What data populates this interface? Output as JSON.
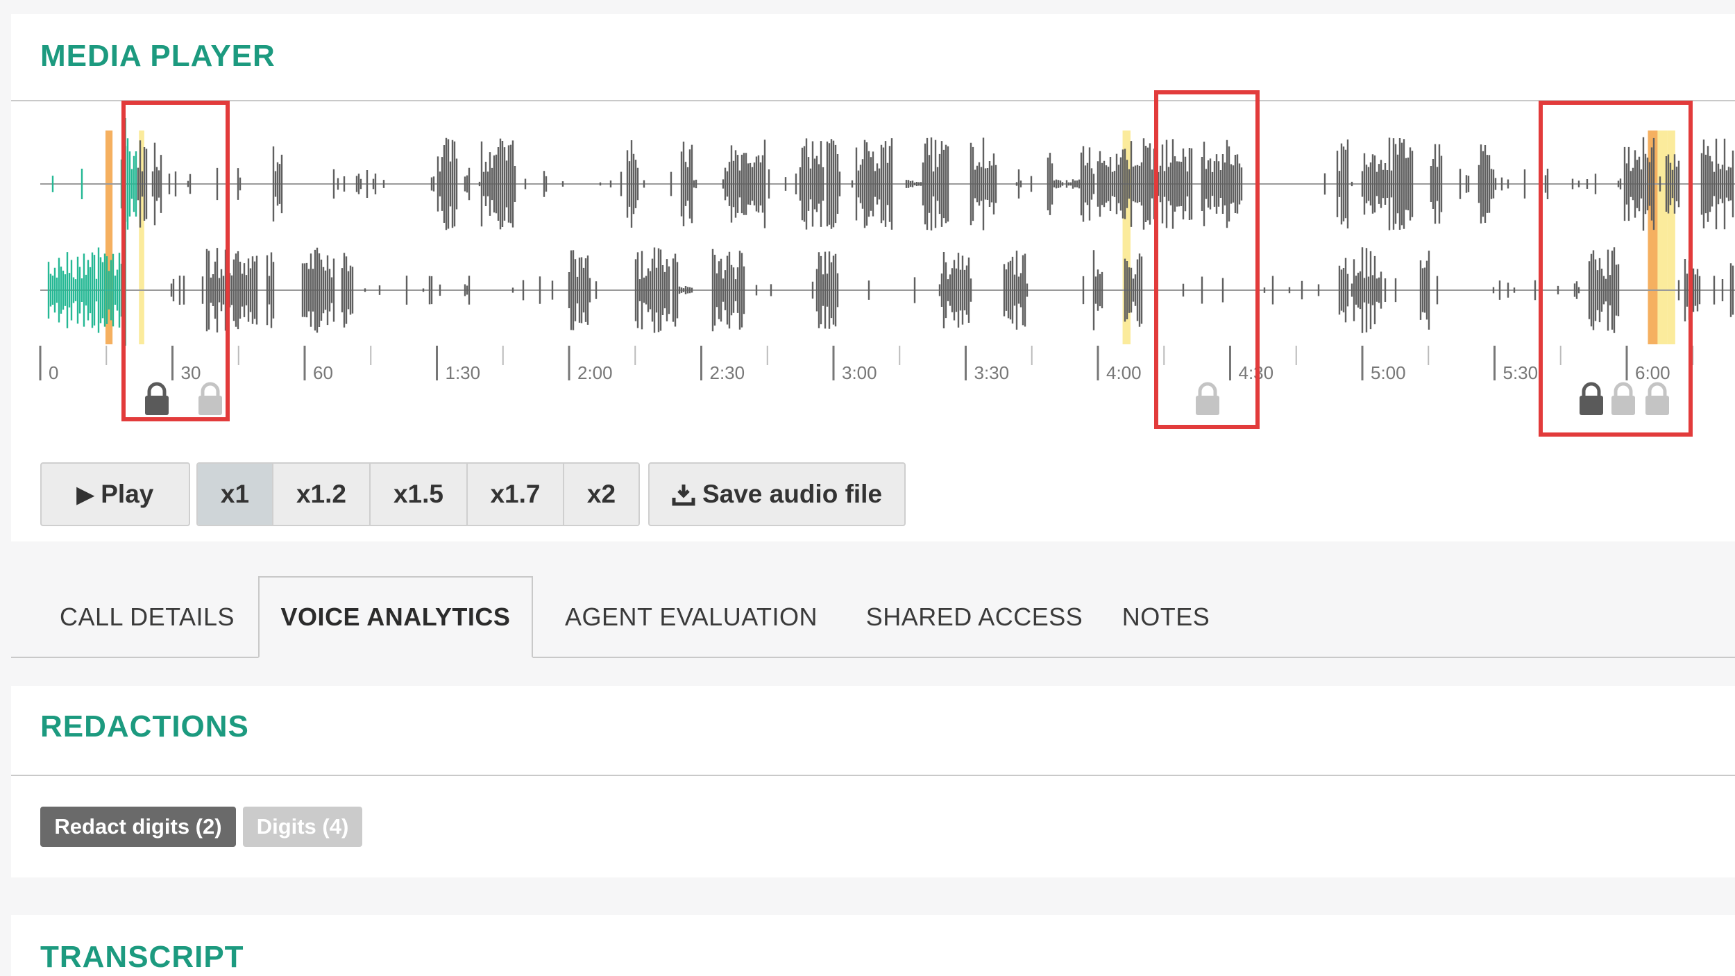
{
  "colors": {
    "accent": "#1c9a7f",
    "waveform": "#5f5f5f",
    "played": "#25b894",
    "highlight_orange": "#f5b060",
    "highlight_yellow": "#fbeb9c",
    "annotation_red": "#e23b3b",
    "lock_dark": "#5a5a5a",
    "lock_light": "#c4c4c4",
    "badge_dark": "#6a6a6a",
    "badge_light": "#cbcbcb"
  },
  "media_player": {
    "title": "MEDIA  PLAYER",
    "timeline_ticks": [
      "0",
      "30",
      "60",
      "1:30",
      "2:00",
      "2:30",
      "3:00",
      "3:30",
      "4:00",
      "4:30",
      "5:00",
      "5:30",
      "6:00"
    ],
    "play_label": "Play",
    "play_icon": "play-icon",
    "speeds": [
      {
        "label": "x1",
        "active": true
      },
      {
        "label": "x1.2",
        "active": false
      },
      {
        "label": "x1.5",
        "active": false
      },
      {
        "label": "x1.7",
        "active": false
      },
      {
        "label": "x2",
        "active": false
      }
    ],
    "save_label": "Save audio file",
    "save_icon": "download-icon",
    "lock_icon": "lock-icon"
  },
  "tabs": [
    {
      "label": "CALL DETAILS",
      "active": false
    },
    {
      "label": "VOICE ANALYTICS",
      "active": true
    },
    {
      "label": "AGENT EVALUATION",
      "active": false
    },
    {
      "label": "SHARED ACCESS",
      "active": false
    },
    {
      "label": "NOTES",
      "active": false
    }
  ],
  "redactions": {
    "title": "REDACTIONS",
    "badges": [
      {
        "label": "Redact digits (2)",
        "style": "dark"
      },
      {
        "label": "Digits (4)",
        "style": "light"
      }
    ]
  },
  "transcript": {
    "title": "TRANSCRIPT"
  }
}
